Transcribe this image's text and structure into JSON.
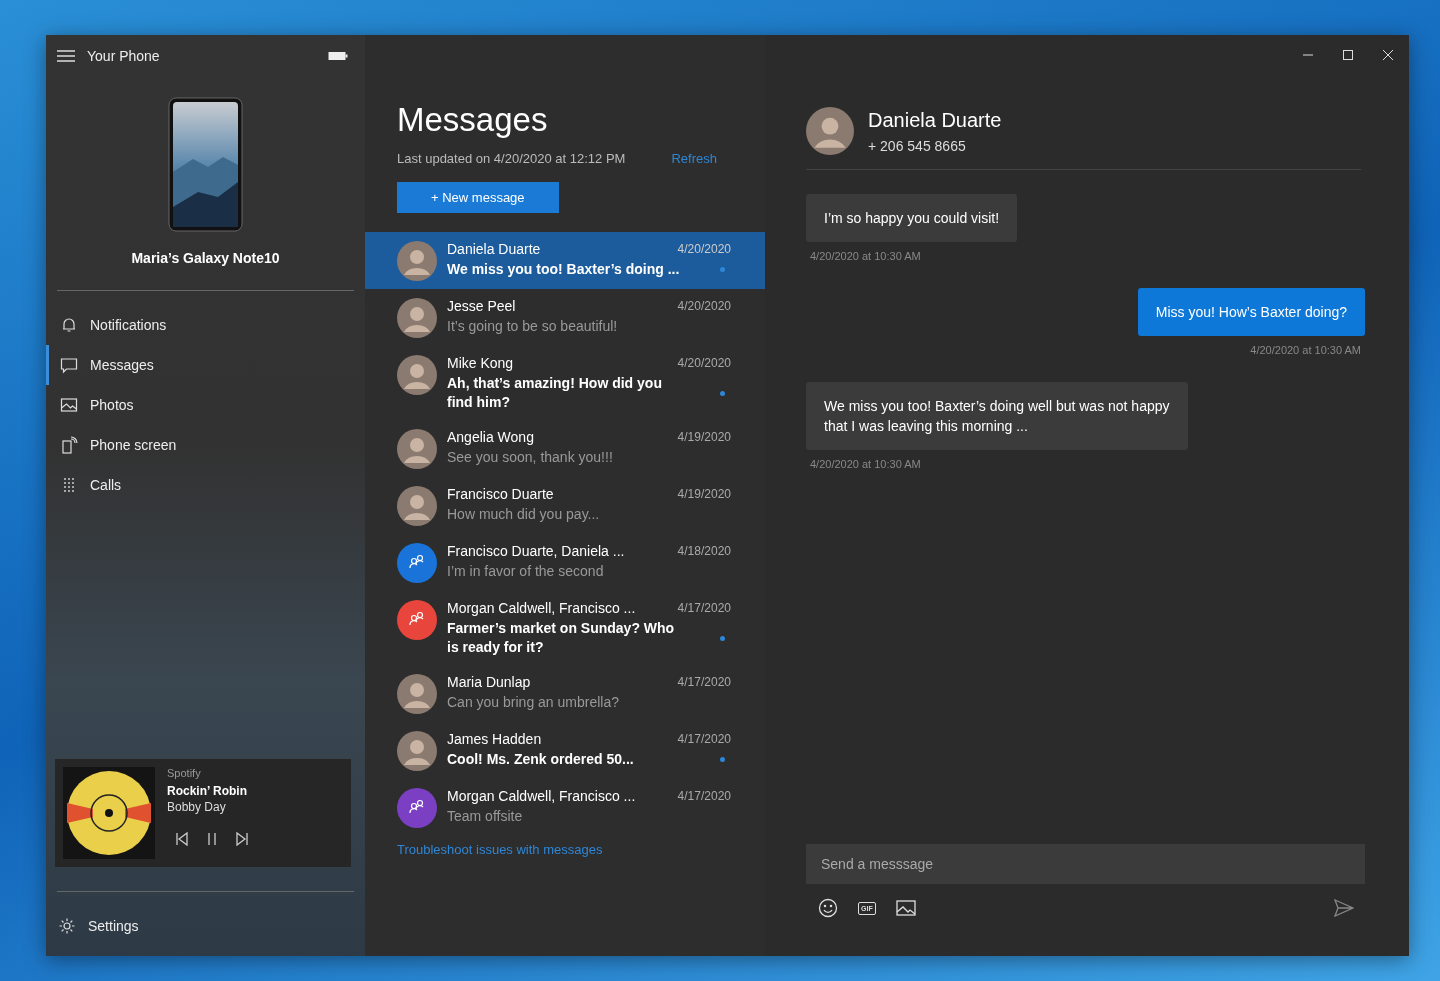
{
  "window": {
    "title": "Your Phone"
  },
  "device": {
    "name": "Maria’s Galaxy Note10"
  },
  "nav": [
    {
      "label": "Notifications",
      "kind": "bell",
      "selected": false
    },
    {
      "label": "Messages",
      "kind": "chat",
      "selected": true
    },
    {
      "label": "Photos",
      "kind": "photo",
      "selected": false
    },
    {
      "label": "Phone screen",
      "kind": "screen",
      "selected": false
    },
    {
      "label": "Calls",
      "kind": "dialpad",
      "selected": false
    }
  ],
  "media": {
    "app": "Spotify",
    "track": "Rockin’ Robin",
    "artist": "Bobby Day"
  },
  "settings": {
    "label": "Settings"
  },
  "messages_pane": {
    "title": "Messages",
    "last_updated": "Last updated on 4/20/2020 at 12:12 PM",
    "refresh": "Refresh",
    "new_message": "+ New message",
    "troubleshoot": "Troubleshoot issues with messages"
  },
  "conversations": [
    {
      "name": "Daniela Duarte",
      "date": "4/20/2020",
      "preview": "We miss you too! Baxter’s doing ...",
      "unread": true,
      "selected": true,
      "kind": "person"
    },
    {
      "name": "Jesse Peel",
      "date": "4/20/2020",
      "preview": "It’s going to be so beautiful!",
      "unread": false,
      "selected": false,
      "kind": "person"
    },
    {
      "name": "Mike Kong",
      "date": "4/20/2020",
      "preview": "Ah, that’s amazing! How did you find him?",
      "unread": true,
      "selected": false,
      "kind": "person"
    },
    {
      "name": "Angelia Wong",
      "date": "4/19/2020",
      "preview": "See you soon, thank you!!!",
      "unread": false,
      "selected": false,
      "kind": "person"
    },
    {
      "name": "Francisco Duarte",
      "date": "4/19/2020",
      "preview": "How much did you pay...",
      "unread": false,
      "selected": false,
      "kind": "person"
    },
    {
      "name": "Francisco Duarte, Daniela ...",
      "date": "4/18/2020",
      "preview": "I’m in favor of the second",
      "unread": false,
      "selected": false,
      "kind": "group",
      "color": "#1a73d9"
    },
    {
      "name": "Morgan Caldwell, Francisco ...",
      "date": "4/17/2020",
      "preview": "Farmer’s market on Sunday? Who is ready for it?",
      "unread": true,
      "selected": false,
      "kind": "group",
      "color": "#e8453c"
    },
    {
      "name": "Maria Dunlap",
      "date": "4/17/2020",
      "preview": "Can you bring an umbrella?",
      "unread": false,
      "selected": false,
      "kind": "person"
    },
    {
      "name": "James Hadden",
      "date": "4/17/2020",
      "preview": "Cool! Ms. Zenk ordered 50...",
      "unread": true,
      "selected": false,
      "kind": "person"
    },
    {
      "name": "Morgan Caldwell, Francisco ...",
      "date": "4/17/2020",
      "preview": "Team offsite",
      "unread": false,
      "selected": false,
      "kind": "group",
      "color": "#7b3fc4"
    }
  ],
  "contact": {
    "name": "Daniela Duarte",
    "phone": "+ 206 545 8665"
  },
  "thread": [
    {
      "text": "I’m so happy you could visit!",
      "time": "4/20/2020 at 10:30 AM",
      "kind": "received"
    },
    {
      "text": "Miss you! How’s Baxter doing?",
      "time": "4/20/2020 at 10:30 AM",
      "kind": "sent"
    },
    {
      "text": "We miss you too! Baxter’s doing well but was not happy that I was leaving this morning ...",
      "time": "4/20/2020 at 10:30 AM",
      "kind": "received"
    }
  ],
  "composer": {
    "placeholder": "Send a messsage",
    "gif_label": "GIF"
  }
}
